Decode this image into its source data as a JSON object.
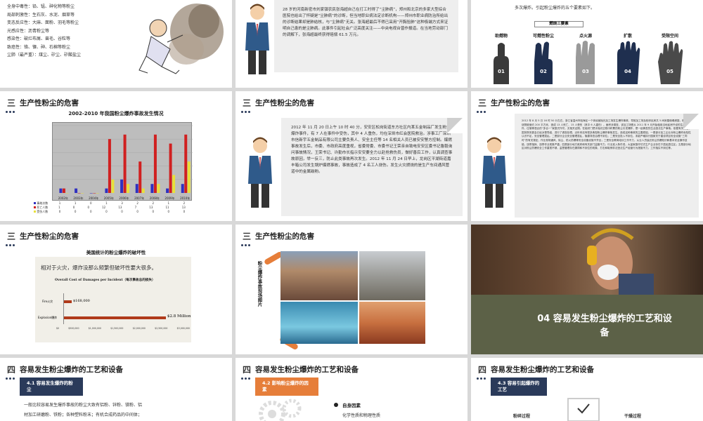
{
  "colors": {
    "navy": "#2a3a5a",
    "orange": "#e67e3a",
    "dark_gray": "#4a4a4a",
    "olive": "#5c6147",
    "chart_red": "#d02020",
    "chart_yellow": "#e8e03a",
    "chart_blue": "#3030c0"
  },
  "slide1": {
    "lines": [
      "全身中毒性：铅、锰、砷化物等粉尘",
      "局部刺激性：生石灰、水泥、烟草等",
      "变态反应性：大麻、面粉、羽毛等粉尘",
      "光感应性：沥青粉尘等",
      "感染性：破烂布屑、兽毛、谷粒等",
      "致癌性：铬、镍、砷、石棉等粉尘",
      "尘肺（最严重）：煤尘、矽尘、矽酸盐尘"
    ]
  },
  "slide2": {
    "text": "28 岁的河南新密市刘家镇农民张海超自己在打工时得了“尘肺病”，郑州和北京的多家大型综合医院也给出了怀疑是“尘肺病”的诊断，但当地职业病法定诊断机构——郑州市职业病防治所给出的诊断结果却是肺结核，与“尘肺病”无关。张海超最后不得已采用“开胸验肺”这种极端方式来证明自己患的是尘肺病。此事件引起社会广泛高度关注——中央电视台曾作报道。在当地劳动部门的调解下，张海超最终获得赔偿 61.5 万元。"
  },
  "slide3": {
    "intro_lines": [
      "多次爆炸。引起粉尘爆炸的五个要素如下。"
    ],
    "header": "燃烧三要素",
    "hands": [
      {
        "num": "01",
        "label": "助燃物",
        "color": "#3a3a3a"
      },
      {
        "num": "02",
        "label": "可燃性粉尘",
        "color": "#1f2f4f"
      },
      {
        "num": "03",
        "label": "点火源",
        "color": "#9a9a9a"
      },
      {
        "num": "04",
        "label": "扩散",
        "color": "#1f2f4f"
      },
      {
        "num": "05",
        "label": "受限空间",
        "color": "#4a4a4a"
      }
    ]
  },
  "section_num_3": "三",
  "section_num_4": "四",
  "title_hazard": "生产性粉尘的危害",
  "slide4": {
    "chart_title": "2002-2010 年我国粉尘爆炸事故发生情况",
    "years": [
      "2002年",
      "2003年",
      "2004年",
      "2005年",
      "2006年",
      "2007年",
      "2008年",
      "2009年",
      "2010年"
    ],
    "legend": [
      "事故次数",
      "死亡人数",
      "受伤人数"
    ],
    "row1": [
      "1",
      "1",
      "0",
      "1",
      "3",
      "2",
      "2",
      "1",
      "2"
    ],
    "row2": [
      "1",
      "0",
      "0",
      "12",
      "13",
      "7",
      "13",
      "11",
      "13"
    ],
    "row3": [
      "0",
      "0",
      "0",
      "0",
      "0",
      "0",
      "0",
      "0",
      "0"
    ]
  },
  "chart_data": {
    "type": "bar",
    "title": "2002-2010 年我国粉尘爆炸事故发生情况",
    "categories": [
      "2002年",
      "2003年",
      "2004年",
      "2005年",
      "2006年",
      "2007年",
      "2008年",
      "2009年",
      "2010年"
    ],
    "series": [
      {
        "name": "事故次数",
        "values": [
          1,
          1,
          0,
          1,
          3,
          2,
          2,
          1,
          2
        ]
      },
      {
        "name": "死亡人数",
        "values": [
          1,
          0,
          0,
          12,
          13,
          7,
          13,
          11,
          13
        ]
      },
      {
        "name": "受伤人数",
        "values": [
          0,
          0,
          0,
          3,
          2,
          1,
          2,
          4,
          7
        ]
      }
    ],
    "ylim": [
      0,
      15
    ]
  },
  "slide5": {
    "text": "2012 年 11 月 20 日上午 10 时 40 分，安安区松岗街道东方社区内某五金制品厂发生粉尘爆炸事件，有 7 人在事件中受伤，其中 4 人重伤，均在深圳市红会医院救治。涉事工厂深圳市信新宇五金制品有限公司主要负责人、安全主任等 14 名相关人员已被安安警方控制。爆燃事故发生后，市委、市政府高度重视，省委常委、市委书记王荣亲自致电安安区委书记鲁毅询问事故情况，王荣书记、许勤市长指示安安要全力以赴抢救伤员，做好善后工作，认真调查事故原因，举一反三，防止此类事故再次发生。2012 年 11 月 24 日早上，龙岗区平湖街道嘉丰箱公司发生锅炉爆燃事故，事故造成了 4 名工人烧伤。发生火灾燃烧的是生产车间通风管道中的金属碳粉。"
  },
  "slide6": {
    "text": "2012 年 8 月 5 日 16 时 50 分左右，浙江省温州市瓯海区一个体经营抛光加工场发生爆炸事故，导致加工场及相邻民房共 5 间房屋倒塌燃毁，爆炸燃烧物致使约 200 平方米，造成 13 人死亡、15 人受伤（其中 6 人重伤）。面积涉调查，该加工场是从 2011 年 9 月开始租用当地民房开设的生产，铸件、住宿等混合的“多合一”家庭式作坊，无相关证照。在组织门把手抛光过程中积累的粉尘引发爆炸，是一起典型的生活违法生产事故。依据有关规定，国务院安委会已经派督导组，进行了调查处理。近年来还有很多典型粉尘爆炸事故发生。造成这种事故的主要原因，一是部分加工企业对粉尘爆炸危险性认识不足，安全管理混乱。二是部分企业安全管理混乱，隐患排查治理不到位；二是安全投入不到位，未能严格执行国家关于建设项目安全设施“三同时”的有关规定，作业现场通风、除尘、防火防爆等安全设备设施不齐全；三是安全教育培训工作不力，从业人员缺乏粉尘防爆知识和基本安全操作技能，违章指挥、违章作业现象严重；四是部分地方政府和有关部门监管不力，行业准入条件低，大量家庭作坊式生产企业存在于居民居住区；五是部分地区对粉尘防爆安全工作重视不够，监督管理存在漏洞和不到位的现象，打击和取缔非法违法生产经营行为措施不力，工作落实不到位等。"
  },
  "slide7": {
    "title": "美国统计的粉尘爆炸的破坏性",
    "quote": "相对于火灾，爆炸没那么频繁但破坏性要大很多。",
    "chart_title": "Overall Cost of Damages per Incident（每次事故总的损失）",
    "fire_label": "Fire火灾",
    "fire_value": "$168,000",
    "explosion_label": "Explosion爆炸",
    "explosion_value": "$2.8 Million",
    "ticks": [
      "$0",
      "$500,000",
      "$1,000,000",
      "$1,500,000",
      "$2,000,000",
      "$2,500,000",
      "$3,000,000"
    ]
  },
  "slide8": {
    "side_label": "粉尘爆炸事故现场图片"
  },
  "slide9": {
    "title": "04 容易发生粉尘爆炸的工艺和设备"
  },
  "title_process": "容易发生粉尘爆炸的工艺和设备",
  "slide10": {
    "badge": "4.1  容易发生爆炸的粉尘",
    "line1": "一般比较容易发生爆炸事故的粉尘大致有铝粉、锌粉、镁粉、铝",
    "line2": "材加工研磨粉、铁粉；各种塑料粉末；有机合成药品的中间体；"
  },
  "slide11": {
    "badge": "4.2  影响粉尘爆炸的因素",
    "item1": "自身因素",
    "item2": "化学性质和物理性质"
  },
  "slide12": {
    "badge": "4.3  容易引起爆炸的工艺",
    "left": "粉碎过程",
    "right": "干燥过程"
  }
}
